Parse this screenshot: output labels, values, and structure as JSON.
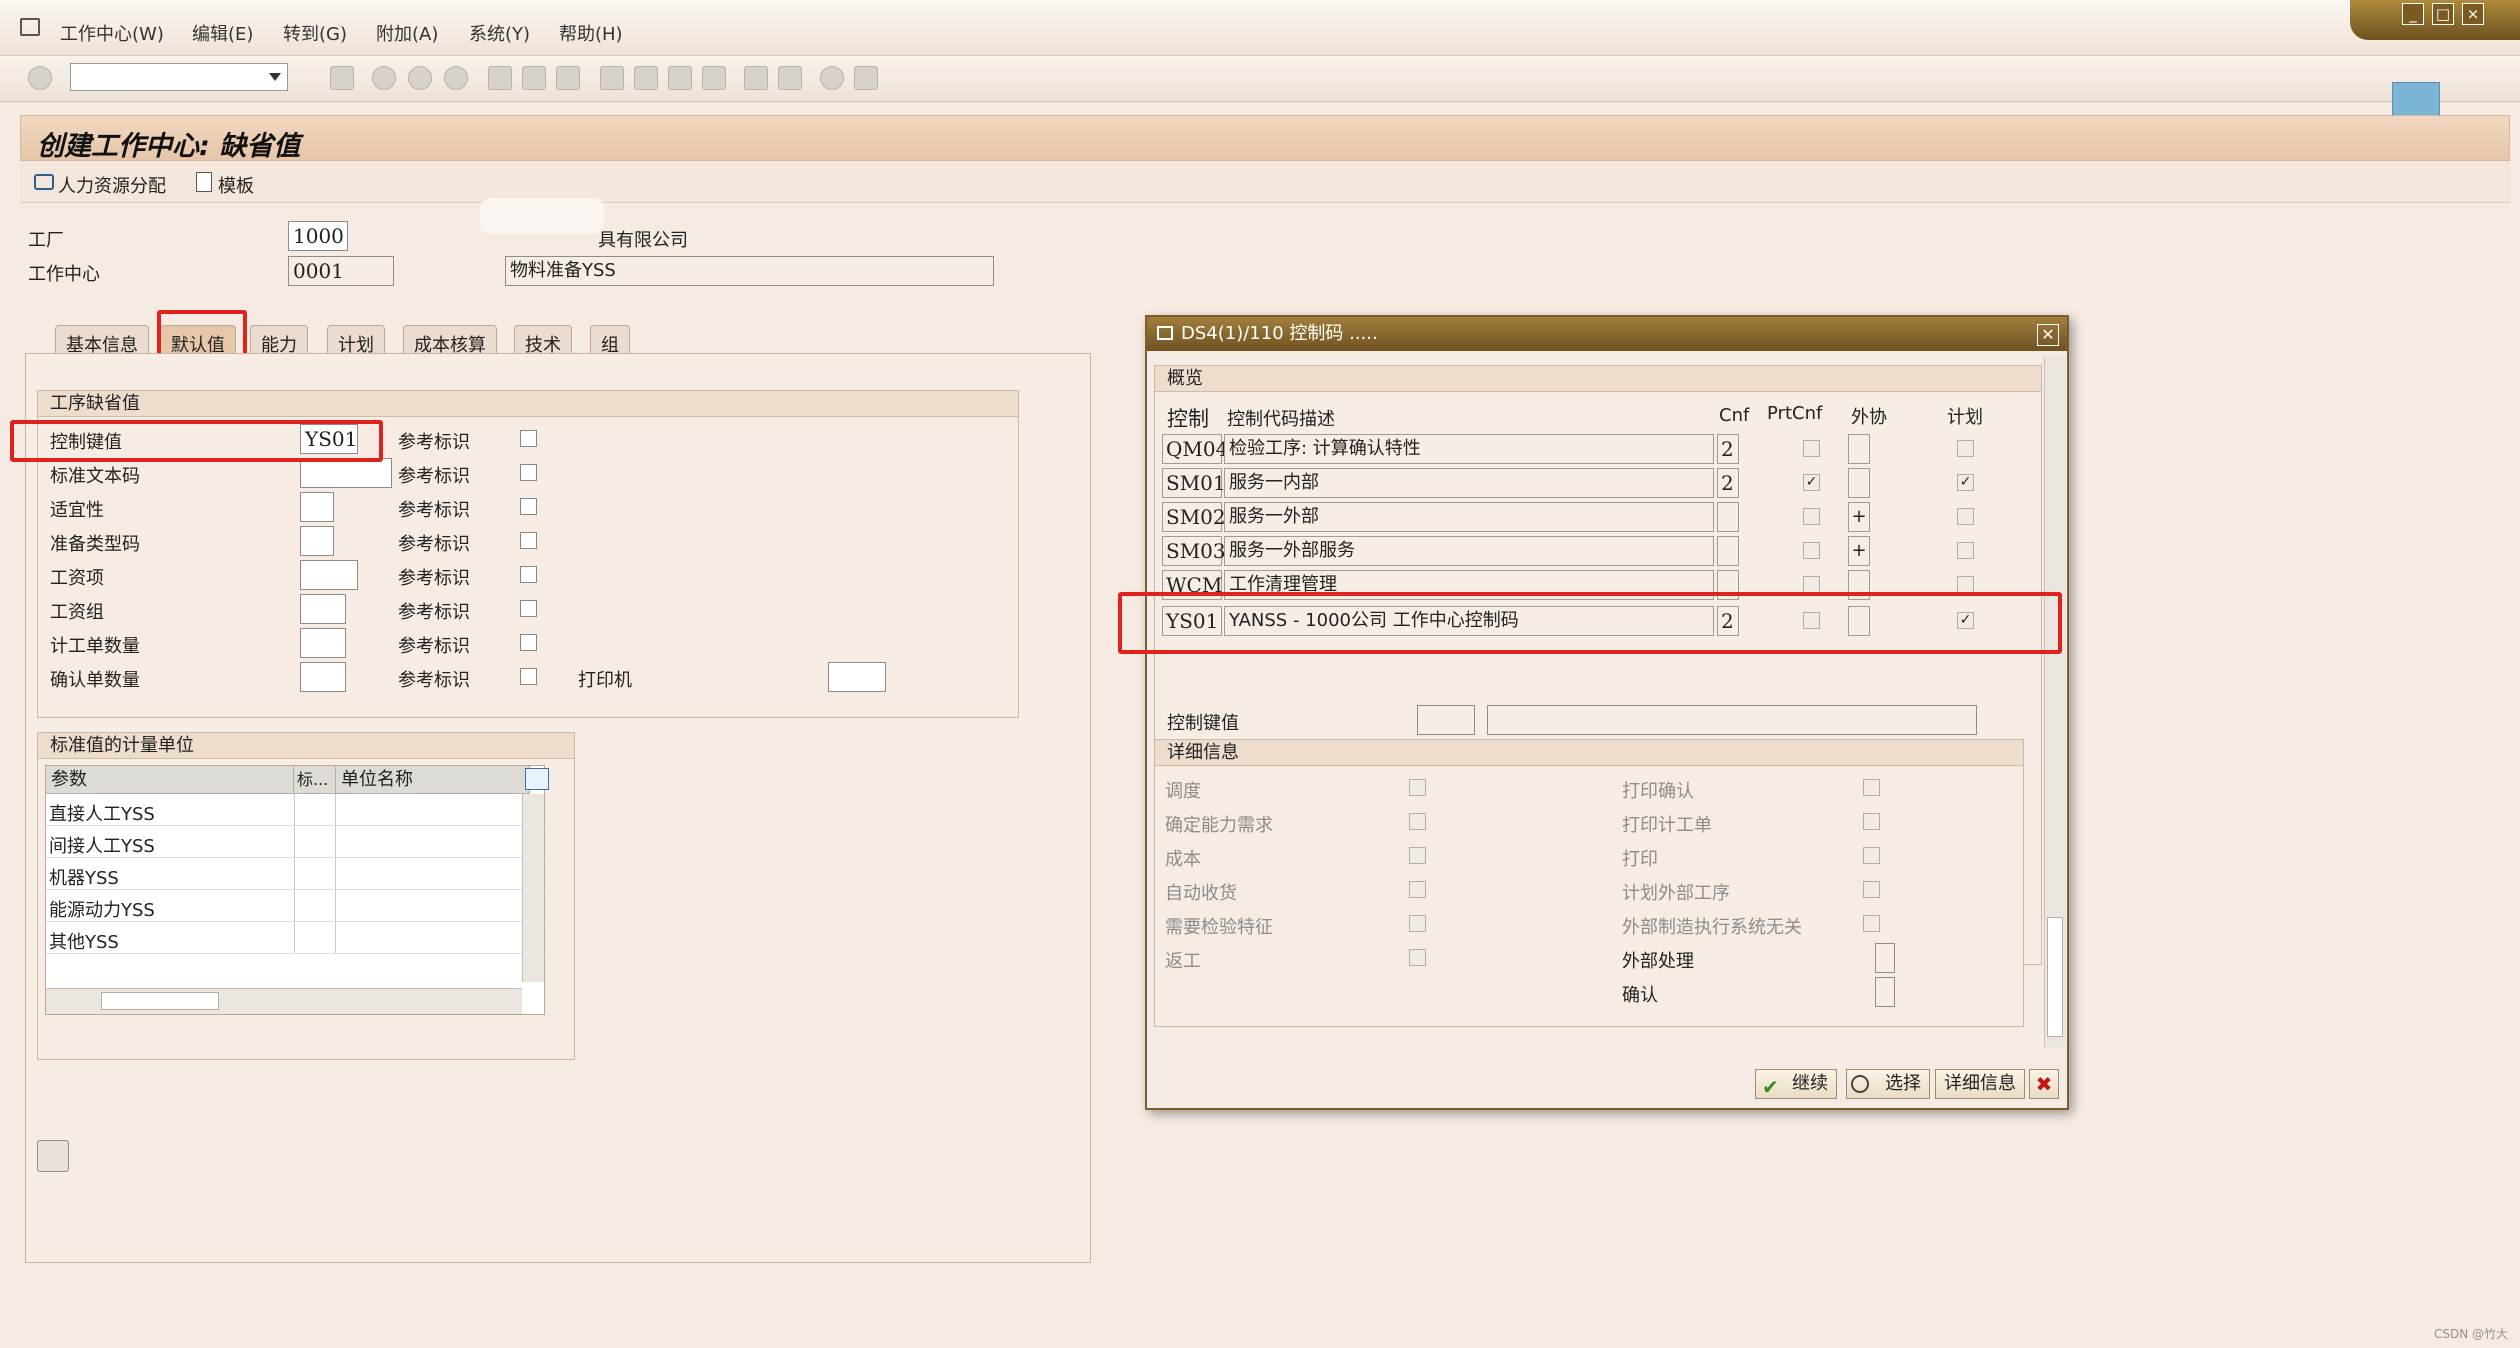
{
  "menu": {
    "items": [
      "工作中心(W)",
      "编辑(E)",
      "转到(G)",
      "附加(A)",
      "系统(Y)",
      "帮助(H)"
    ],
    "window_controls": [
      "_",
      "□",
      "×"
    ]
  },
  "page": {
    "title": "创建工作中心: 缺省值",
    "app_buttons": {
      "hr": "人力资源分配",
      "template": "模板"
    }
  },
  "header_fields": {
    "plant_label": "工厂",
    "plant_value": "1000",
    "plant_desc": "具有限公司",
    "wc_label": "工作中心",
    "wc_value": "0001",
    "wc_desc": "物料准备YSS"
  },
  "tabs": [
    "基本信息",
    "默认值",
    "能力",
    "计划",
    "成本核算",
    "技术",
    "组"
  ],
  "defaults_group": {
    "title": "工序缺省值",
    "rows": [
      {
        "label": "控制键值",
        "value": "YS01",
        "ref": "参考标识"
      },
      {
        "label": "标准文本码",
        "value": "",
        "ref": "参考标识"
      },
      {
        "label": "适宜性",
        "value": "",
        "ref": "参考标识"
      },
      {
        "label": "准备类型码",
        "value": "",
        "ref": "参考标识"
      },
      {
        "label": "工资项",
        "value": "",
        "ref": "参考标识"
      },
      {
        "label": "工资组",
        "value": "",
        "ref": "参考标识"
      },
      {
        "label": "计工单数量",
        "value": "",
        "ref": "参考标识"
      },
      {
        "label": "确认单数量",
        "value": "",
        "ref": "参考标识"
      }
    ],
    "printer_label": "打印机"
  },
  "units_group": {
    "title": "标准值的计量单位",
    "columns": [
      "参数",
      "标...",
      "单位名称"
    ],
    "rows": [
      "直接人工YSS",
      "间接人工YSS",
      "机器YSS",
      "能源动力YSS",
      "其他YSS"
    ]
  },
  "dialog": {
    "title": "DS4(1)/110 控制码 .....",
    "overview_title": "概览",
    "columns": {
      "ctrl": "控制",
      "desc": "控制代码描述",
      "cnf": "Cnf",
      "prtcnf": "PrtCnf",
      "ext": "外协",
      "plan": "计划"
    },
    "rows": [
      {
        "code": "QM04",
        "desc": "检验工序: 计算确认特性",
        "cnf": "2",
        "prtcnf": false,
        "ext": "",
        "plan": false
      },
      {
        "code": "SM01",
        "desc": "服务一内部",
        "cnf": "2",
        "prtcnf": true,
        "ext": "",
        "plan": true
      },
      {
        "code": "SM02",
        "desc": "服务一外部",
        "cnf": "",
        "prtcnf": false,
        "ext": "+",
        "plan": false
      },
      {
        "code": "SM03",
        "desc": "服务一外部服务",
        "cnf": "",
        "prtcnf": false,
        "ext": "+",
        "plan": false
      },
      {
        "code": "WCM",
        "desc": "工作清理管理",
        "cnf": "",
        "prtcnf": false,
        "ext": "",
        "plan": false
      },
      {
        "code": "YS01",
        "desc": "YANSS - 1000公司 工作中心控制码",
        "cnf": "2",
        "prtcnf": false,
        "ext": "",
        "plan": true
      }
    ],
    "control_key_label": "控制键值",
    "details_title": "详细信息",
    "details_left": [
      "调度",
      "确定能力需求",
      "成本",
      "自动收货",
      "需要检验特征",
      "返工"
    ],
    "details_right": [
      "打印确认",
      "打印计工单",
      "打印",
      "计划外部工序",
      "外部制造执行系统无关"
    ],
    "details_fields": [
      "外部处理",
      "确认"
    ],
    "buttons": {
      "continue": "继续",
      "select": "选择",
      "details": "详细信息"
    }
  },
  "watermark": "CSDN @竹大"
}
